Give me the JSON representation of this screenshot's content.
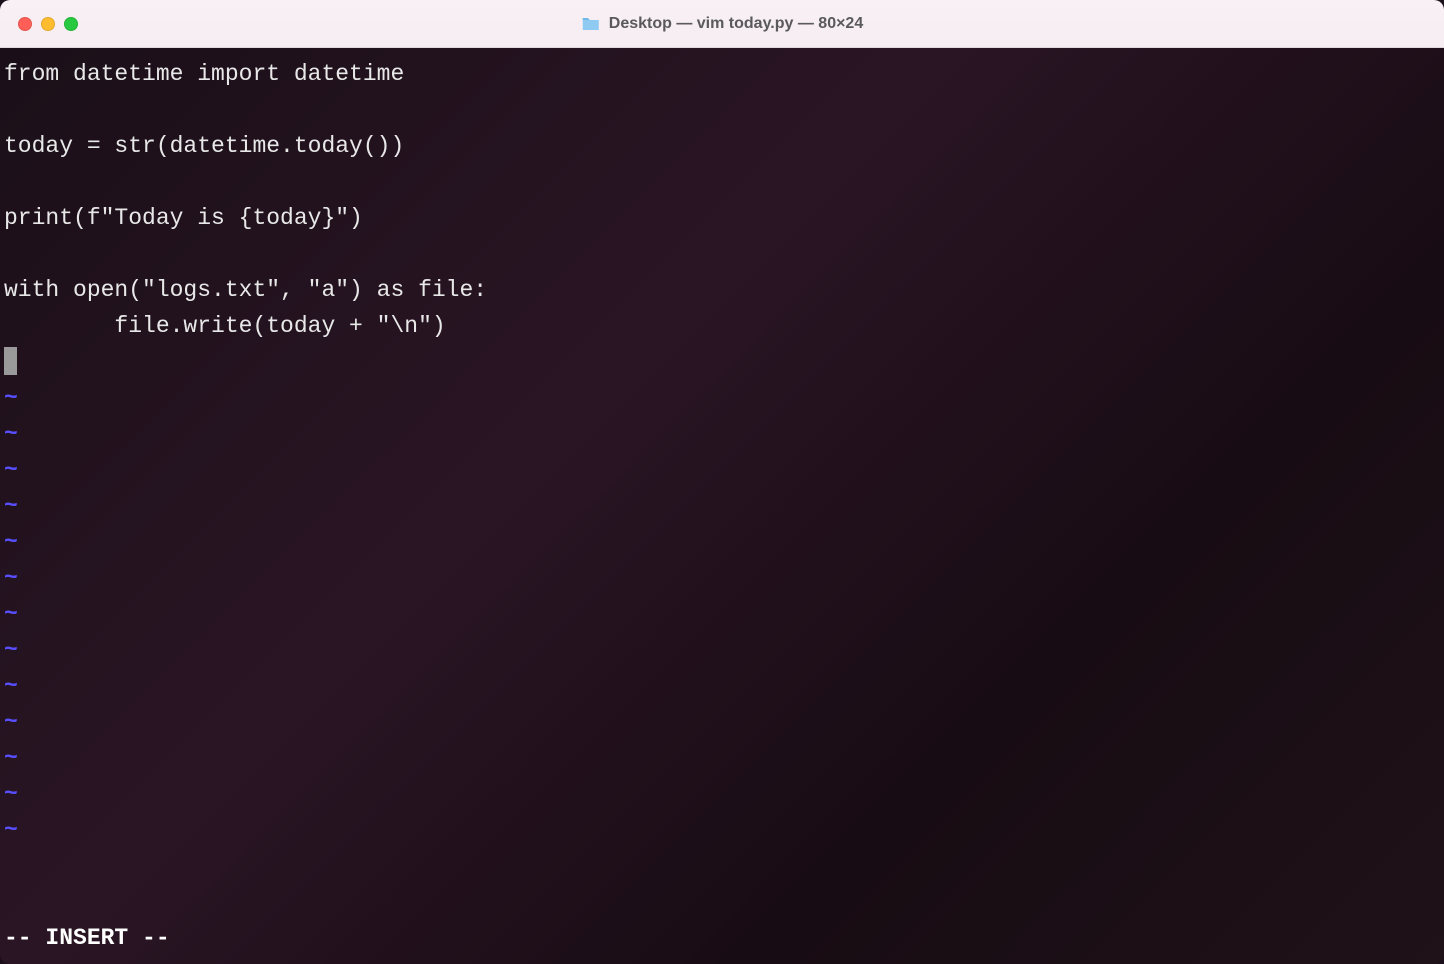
{
  "window": {
    "title": "Desktop — vim today.py — 80×24"
  },
  "code": {
    "lines": [
      "from datetime import datetime",
      "",
      "today = str(datetime.today())",
      "",
      "print(f\"Today is {today}\")",
      "",
      "with open(\"logs.txt\", \"a\") as file:",
      "        file.write(today + \"\\n\")"
    ]
  },
  "tilde": "~",
  "tilde_count": 13,
  "status": "-- INSERT --"
}
